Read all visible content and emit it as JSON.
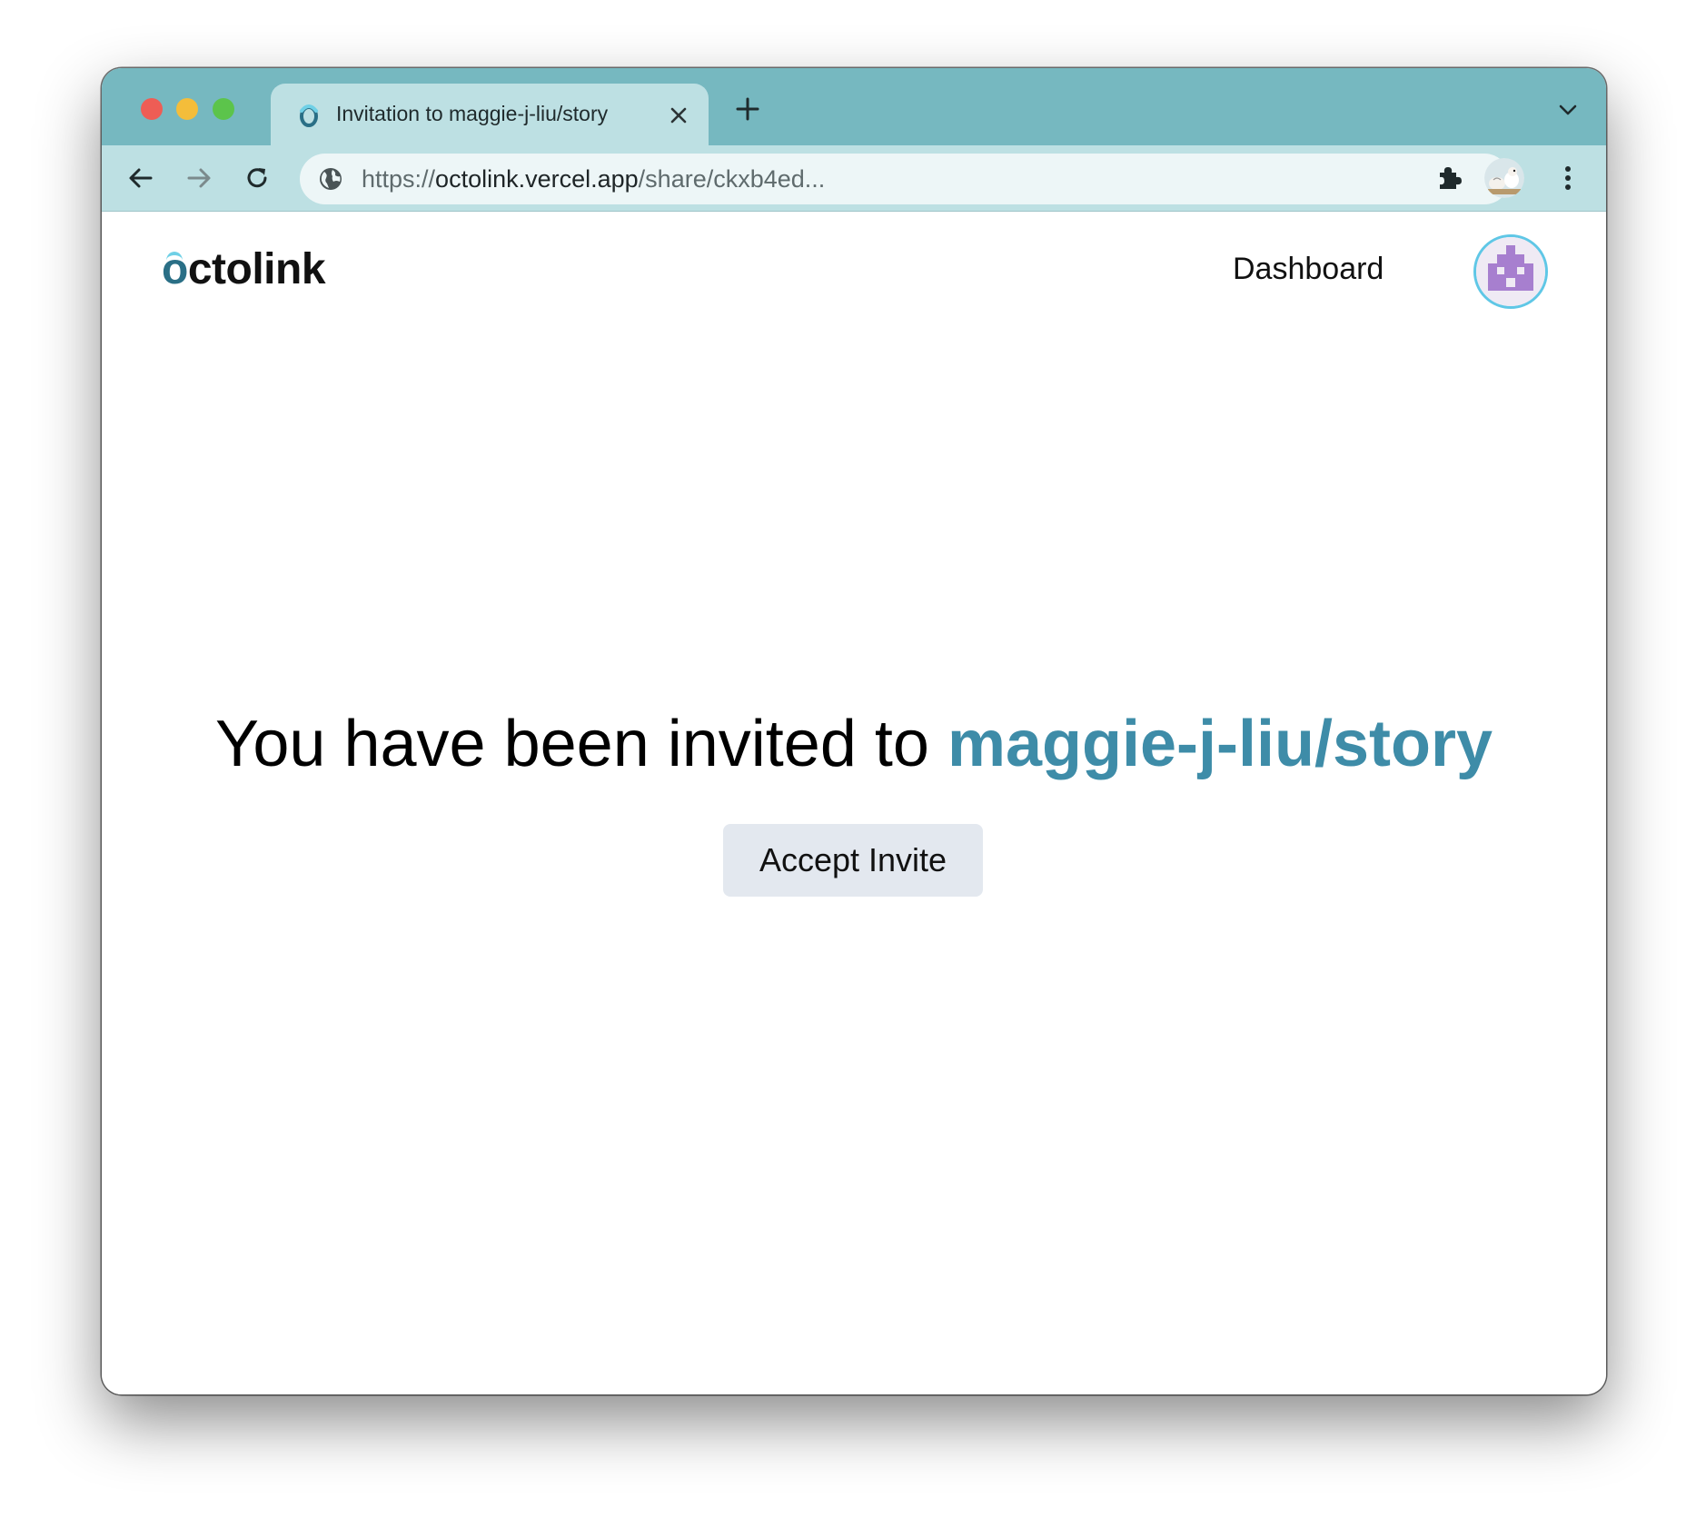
{
  "browser": {
    "tab": {
      "title": "Invitation to maggie-j-liu/story",
      "favicon_icon": "octolink-favicon-icon",
      "close_icon": "close-icon"
    },
    "new_tab_icon": "plus-icon",
    "tab_search_icon": "chevron-down-icon",
    "address_bar": {
      "scheme": "https://",
      "host": "octolink.vercel.app",
      "path": "/share/ckxb4ed...",
      "site_icon": "globe-icon"
    },
    "extensions_icon": "puzzle-icon",
    "profile_icon": "profile-avatar-icon",
    "menu_icon": "kebab-menu-icon"
  },
  "header": {
    "logo_o": "o",
    "logo_rest": "ctolink",
    "nav_dashboard": "Dashboard",
    "avatar_icon": "identicon-avatar-icon"
  },
  "main": {
    "invite_prefix": "You have been invited to ",
    "repo_name": "maggie-j-liu/story",
    "accept_label": "Accept Invite"
  },
  "colors": {
    "tab_strip": "#76b8c0",
    "toolbar": "#bde0e3",
    "repo_accent": "#3e8ca8",
    "button_bg": "#e3e8ef",
    "avatar_ring": "#5fc7e6",
    "identicon": "#a77fcf"
  }
}
